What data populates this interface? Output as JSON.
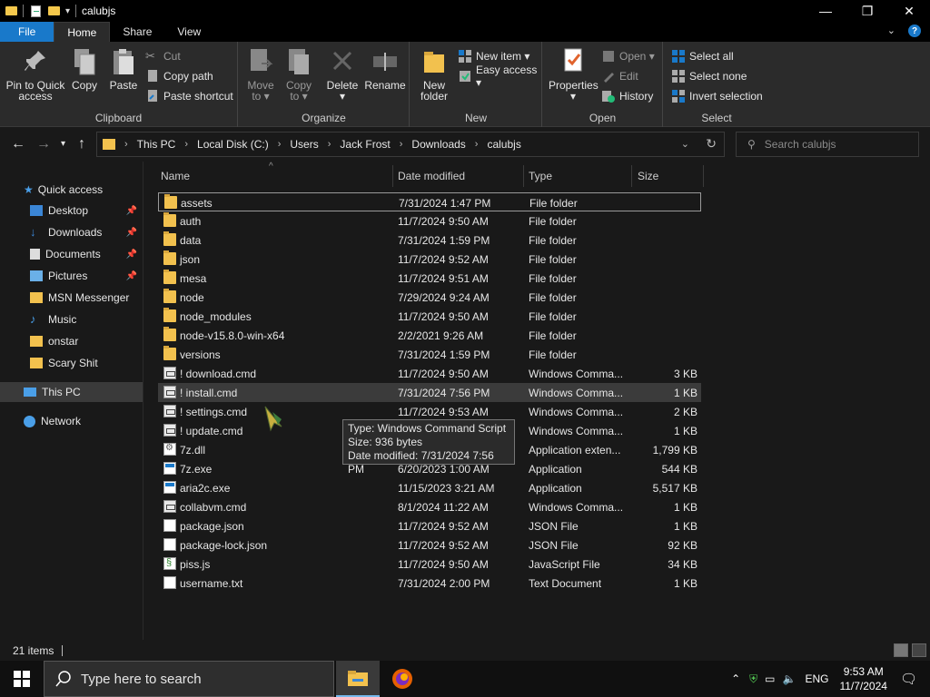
{
  "window": {
    "title": "calubjs",
    "controls": {
      "minimize": "—",
      "maximize": "❐",
      "close": "✕"
    }
  },
  "ribbon": {
    "tabs": [
      "File",
      "Home",
      "Share",
      "View"
    ],
    "clipboard": {
      "label": "Clipboard",
      "pin": [
        "Pin to Quick",
        "access"
      ],
      "copy": "Copy",
      "paste": "Paste",
      "cut": "Cut",
      "copy_path": "Copy path",
      "paste_shortcut": "Paste shortcut"
    },
    "organize": {
      "label": "Organize",
      "move_to": [
        "Move",
        "to ▾"
      ],
      "copy_to": [
        "Copy",
        "to ▾"
      ],
      "delete": [
        "Delete",
        "▾"
      ],
      "rename": "Rename"
    },
    "new": {
      "label": "New",
      "new_folder": [
        "New",
        "folder"
      ],
      "new_item": "New item ▾",
      "easy_access": "Easy access ▾"
    },
    "open": {
      "label": "Open",
      "properties": [
        "Properties",
        "▾"
      ],
      "open": "Open ▾",
      "edit": "Edit",
      "history": "History"
    },
    "select": {
      "label": "Select",
      "select_all": "Select all",
      "select_none": "Select none",
      "invert": "Invert selection"
    }
  },
  "address": {
    "crumbs": [
      "This PC",
      "Local Disk (C:)",
      "Users",
      "Jack Frost",
      "Downloads",
      "calubjs"
    ],
    "search_placeholder": "Search calubjs"
  },
  "navpane": {
    "quick_access": "Quick access",
    "items": [
      {
        "label": "Desktop",
        "icon": "desktop-icon",
        "pinned": true
      },
      {
        "label": "Downloads",
        "icon": "downloads-icon",
        "pinned": true
      },
      {
        "label": "Documents",
        "icon": "documents-icon",
        "pinned": true
      },
      {
        "label": "Pictures",
        "icon": "pictures-icon",
        "pinned": true
      },
      {
        "label": "MSN Messenger",
        "icon": "folder-icon",
        "pinned": false
      },
      {
        "label": "Music",
        "icon": "music-icon",
        "pinned": false
      },
      {
        "label": "onstar",
        "icon": "folder-icon",
        "pinned": false
      },
      {
        "label": "Scary Shit",
        "icon": "folder-icon",
        "pinned": false
      }
    ],
    "this_pc": "This PC",
    "network": "Network"
  },
  "columns": {
    "name": "Name",
    "date": "Date modified",
    "type": "Type",
    "size": "Size"
  },
  "files": [
    {
      "name": "assets",
      "date": "7/31/2024 1:47 PM",
      "type": "File folder",
      "size": "",
      "icon": "folder"
    },
    {
      "name": "auth",
      "date": "11/7/2024 9:50 AM",
      "type": "File folder",
      "size": "",
      "icon": "folder"
    },
    {
      "name": "data",
      "date": "7/31/2024 1:59 PM",
      "type": "File folder",
      "size": "",
      "icon": "folder"
    },
    {
      "name": "json",
      "date": "11/7/2024 9:52 AM",
      "type": "File folder",
      "size": "",
      "icon": "folder"
    },
    {
      "name": "mesa",
      "date": "11/7/2024 9:51 AM",
      "type": "File folder",
      "size": "",
      "icon": "folder"
    },
    {
      "name": "node",
      "date": "7/29/2024 9:24 AM",
      "type": "File folder",
      "size": "",
      "icon": "folder"
    },
    {
      "name": "node_modules",
      "date": "11/7/2024 9:50 AM",
      "type": "File folder",
      "size": "",
      "icon": "folder"
    },
    {
      "name": "node-v15.8.0-win-x64",
      "date": "2/2/2021 9:26 AM",
      "type": "File folder",
      "size": "",
      "icon": "folder"
    },
    {
      "name": "versions",
      "date": "7/31/2024 1:59 PM",
      "type": "File folder",
      "size": "",
      "icon": "folder"
    },
    {
      "name": "! download.cmd",
      "date": "11/7/2024 9:50 AM",
      "type": "Windows Comma...",
      "size": "3 KB",
      "icon": "cmd"
    },
    {
      "name": "! install.cmd",
      "date": "7/31/2024 7:56 PM",
      "type": "Windows Comma...",
      "size": "1 KB",
      "icon": "cmd"
    },
    {
      "name": "! settings.cmd",
      "date": "11/7/2024 9:53 AM",
      "type": "Windows Comma...",
      "size": "2 KB",
      "icon": "cmd"
    },
    {
      "name": "! update.cmd",
      "date": "11/7/2024 9:50 AM",
      "type": "Windows Comma...",
      "size": "1 KB",
      "icon": "cmd"
    },
    {
      "name": "7z.dll",
      "date": "11/7/2024 9:52 AM",
      "type": "Application exten...",
      "size": "1,799 KB",
      "icon": "dll"
    },
    {
      "name": "7z.exe",
      "date": "6/20/2023 1:00 AM",
      "type": "Application",
      "size": "544 KB",
      "icon": "exe"
    },
    {
      "name": "aria2c.exe",
      "date": "11/15/2023 3:21 AM",
      "type": "Application",
      "size": "5,517 KB",
      "icon": "exe"
    },
    {
      "name": "collabvm.cmd",
      "date": "8/1/2024 11:22 AM",
      "type": "Windows Comma...",
      "size": "1 KB",
      "icon": "cmd"
    },
    {
      "name": "package.json",
      "date": "11/7/2024 9:52 AM",
      "type": "JSON File",
      "size": "1 KB",
      "icon": "page"
    },
    {
      "name": "package-lock.json",
      "date": "11/7/2024 9:52 AM",
      "type": "JSON File",
      "size": "92 KB",
      "icon": "page"
    },
    {
      "name": "piss.js",
      "date": "11/7/2024 9:50 AM",
      "type": "JavaScript File",
      "size": "34 KB",
      "icon": "js"
    },
    {
      "name": "username.txt",
      "date": "7/31/2024 2:00 PM",
      "type": "Text Document",
      "size": "1 KB",
      "icon": "page"
    }
  ],
  "tooltip": {
    "type": "Type: Windows Command Script",
    "size": "Size: 936 bytes",
    "date": "Date modified: 7/31/2024 7:56 PM"
  },
  "status": {
    "count": "21 items"
  },
  "taskbar": {
    "search_placeholder": "Type here to search",
    "language": "ENG",
    "time": "9:53 AM",
    "date": "11/7/2024"
  },
  "colors": {
    "accent": "#1979ca",
    "folder": "#f2c14e",
    "background": "#191919"
  }
}
